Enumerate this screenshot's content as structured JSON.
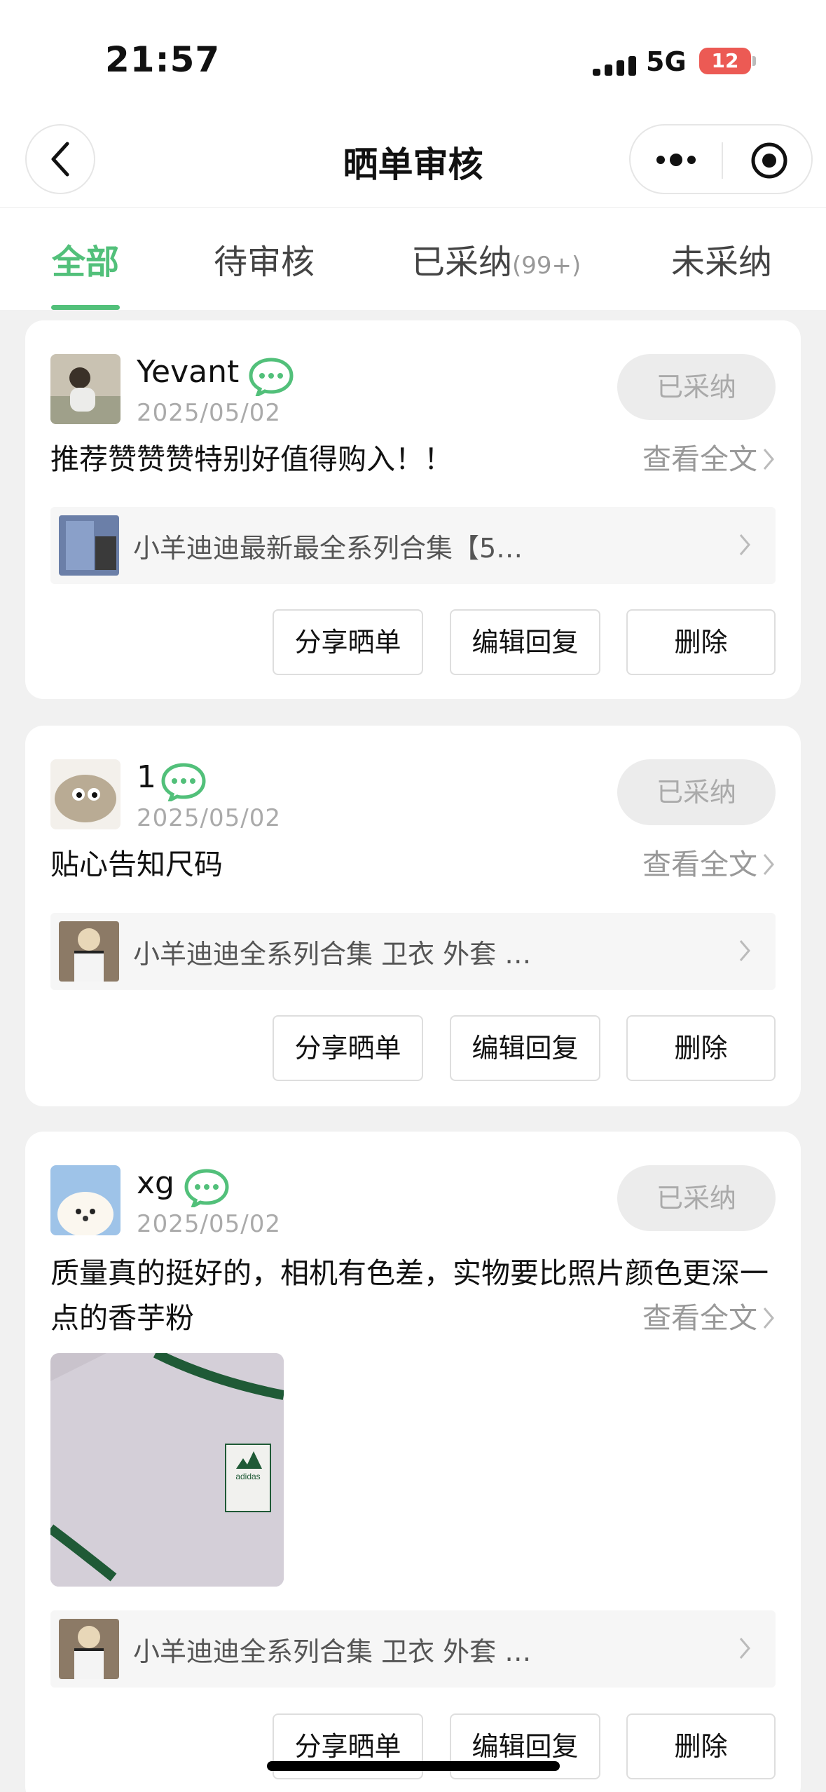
{
  "status_bar": {
    "time": "21:57",
    "network": "5G",
    "battery": "12"
  },
  "nav": {
    "title": "晒单审核",
    "back_icon": "chevron-left-icon",
    "more_icon": "more-dots-icon",
    "target_icon": "target-icon"
  },
  "tabs": [
    {
      "label": "全部",
      "active": true
    },
    {
      "label": "待审核"
    },
    {
      "label": "已采纳",
      "count": "(99+)"
    },
    {
      "label": "未采纳"
    }
  ],
  "accent_color": "#52c07a",
  "read_more_label": "查看全文",
  "buttons": {
    "share": "分享晒单",
    "edit": "编辑回复",
    "delete": "删除"
  },
  "reviews": [
    {
      "username": "Yevant",
      "date": "2025/05/02",
      "status": "已采纳",
      "content": "推荐赞赞赞特别好值得购入！！",
      "product_title": "小羊迪迪最新最全系列合集【5…"
    },
    {
      "username": "1",
      "date": "2025/05/02",
      "status": "已采纳",
      "content": "贴心告知尺码",
      "product_title": "小羊迪迪全系列合集 卫衣 外套 …"
    },
    {
      "username": "xg",
      "date": "2025/05/02",
      "status": "已采纳",
      "content": "质量真的挺好的，相机有色差，实物要比照片颜色更深一点的香芋粉",
      "photo_text": "adidas",
      "product_title": "小羊迪迪全系列合集 卫衣 外套 …"
    }
  ]
}
